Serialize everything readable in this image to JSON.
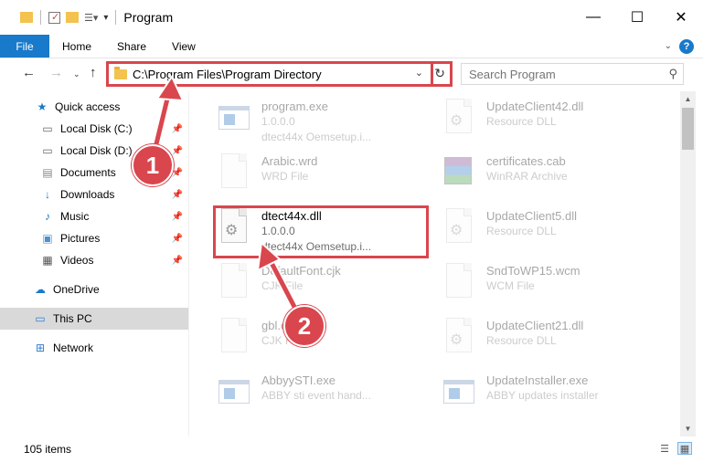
{
  "window": {
    "title": "Program",
    "minimize": "—",
    "maximize": "☐",
    "close": "✕"
  },
  "ribbon": {
    "tabs": [
      "File",
      "Home",
      "Share",
      "View"
    ]
  },
  "address": {
    "path": "C:\\Program Files\\Program Directory"
  },
  "search": {
    "placeholder": "Search Program"
  },
  "sidebar": {
    "items": [
      {
        "label": "Quick access",
        "icon": "star-icon"
      },
      {
        "label": "Local Disk (C:)",
        "icon": "drive-icon"
      },
      {
        "label": "Local Disk (D:)",
        "icon": "drive-icon"
      },
      {
        "label": "Documents",
        "icon": "documents-icon"
      },
      {
        "label": "Downloads",
        "icon": "download-icon"
      },
      {
        "label": "Music",
        "icon": "music-icon"
      },
      {
        "label": "Pictures",
        "icon": "pictures-icon"
      },
      {
        "label": "Videos",
        "icon": "videos-icon"
      },
      {
        "label": "OneDrive",
        "icon": "cloud-icon"
      },
      {
        "label": "This PC",
        "icon": "computer-icon"
      },
      {
        "label": "Network",
        "icon": "network-icon"
      }
    ]
  },
  "files": [
    {
      "name": "program.exe",
      "line1": "1.0.0.0",
      "line2": "dtect44x Oemsetup.i...",
      "icon": "exe-icon"
    },
    {
      "name": "UpdateClient42.dll",
      "line1": "Resource DLL",
      "line2": "",
      "icon": "dll-icon"
    },
    {
      "name": "Arabic.wrd",
      "line1": "WRD File",
      "line2": "",
      "icon": "blank-file-icon"
    },
    {
      "name": "certificates.cab",
      "line1": "WinRAR Archive",
      "line2": "",
      "icon": "archive-icon"
    },
    {
      "name": "dtect44x.dll",
      "line1": "1.0.0.0",
      "line2": "dtect44x Oemsetup.i...",
      "icon": "dll-icon"
    },
    {
      "name": "UpdateClient5.dll",
      "line1": "Resource DLL",
      "line2": "",
      "icon": "dll-icon"
    },
    {
      "name": "DefaultFont.cjk",
      "line1": "CJK File",
      "line2": "",
      "icon": "blank-file-icon"
    },
    {
      "name": "SndToWP15.wcm",
      "line1": "WCM File",
      "line2": "",
      "icon": "blank-file-icon"
    },
    {
      "name": "gbl.cjk",
      "line1": "CJK File",
      "line2": "",
      "icon": "blank-file-icon"
    },
    {
      "name": "UpdateClient21.dll",
      "line1": "Resource DLL",
      "line2": "",
      "icon": "dll-icon"
    },
    {
      "name": "AbbyySTI.exe",
      "line1": "ABBY sti event hand...",
      "line2": "",
      "icon": "exe-icon"
    },
    {
      "name": "UpdateInstaller.exe",
      "line1": "ABBY updates installer",
      "line2": "",
      "icon": "exe-icon"
    }
  ],
  "status": {
    "item_count": "105 items"
  },
  "annotations": {
    "step1": "1",
    "step2": "2"
  },
  "colors": {
    "accent": "#1979ca",
    "highlight": "#d9464d"
  }
}
